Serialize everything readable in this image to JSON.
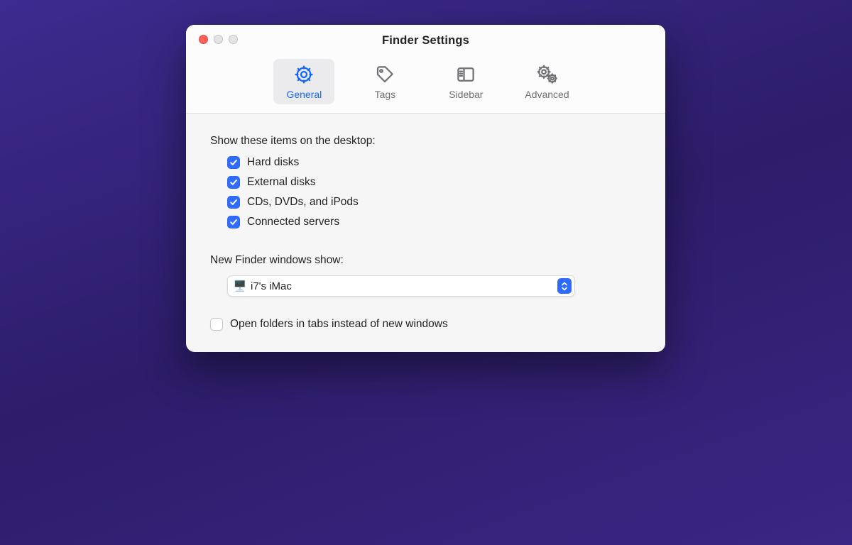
{
  "window": {
    "title": "Finder Settings"
  },
  "tabs": {
    "general": "General",
    "tags": "Tags",
    "sidebar": "Sidebar",
    "advanced": "Advanced"
  },
  "general": {
    "desktop_items_label": "Show these items on the desktop:",
    "items": {
      "hard_disks": "Hard disks",
      "external_disks": "External disks",
      "cds_dvds": "CDs, DVDs, and iPods",
      "servers": "Connected servers"
    },
    "new_window_label": "New Finder windows show:",
    "new_window_value": "i7's iMac",
    "tabs_checkbox_label": "Open folders in tabs instead of new windows"
  }
}
